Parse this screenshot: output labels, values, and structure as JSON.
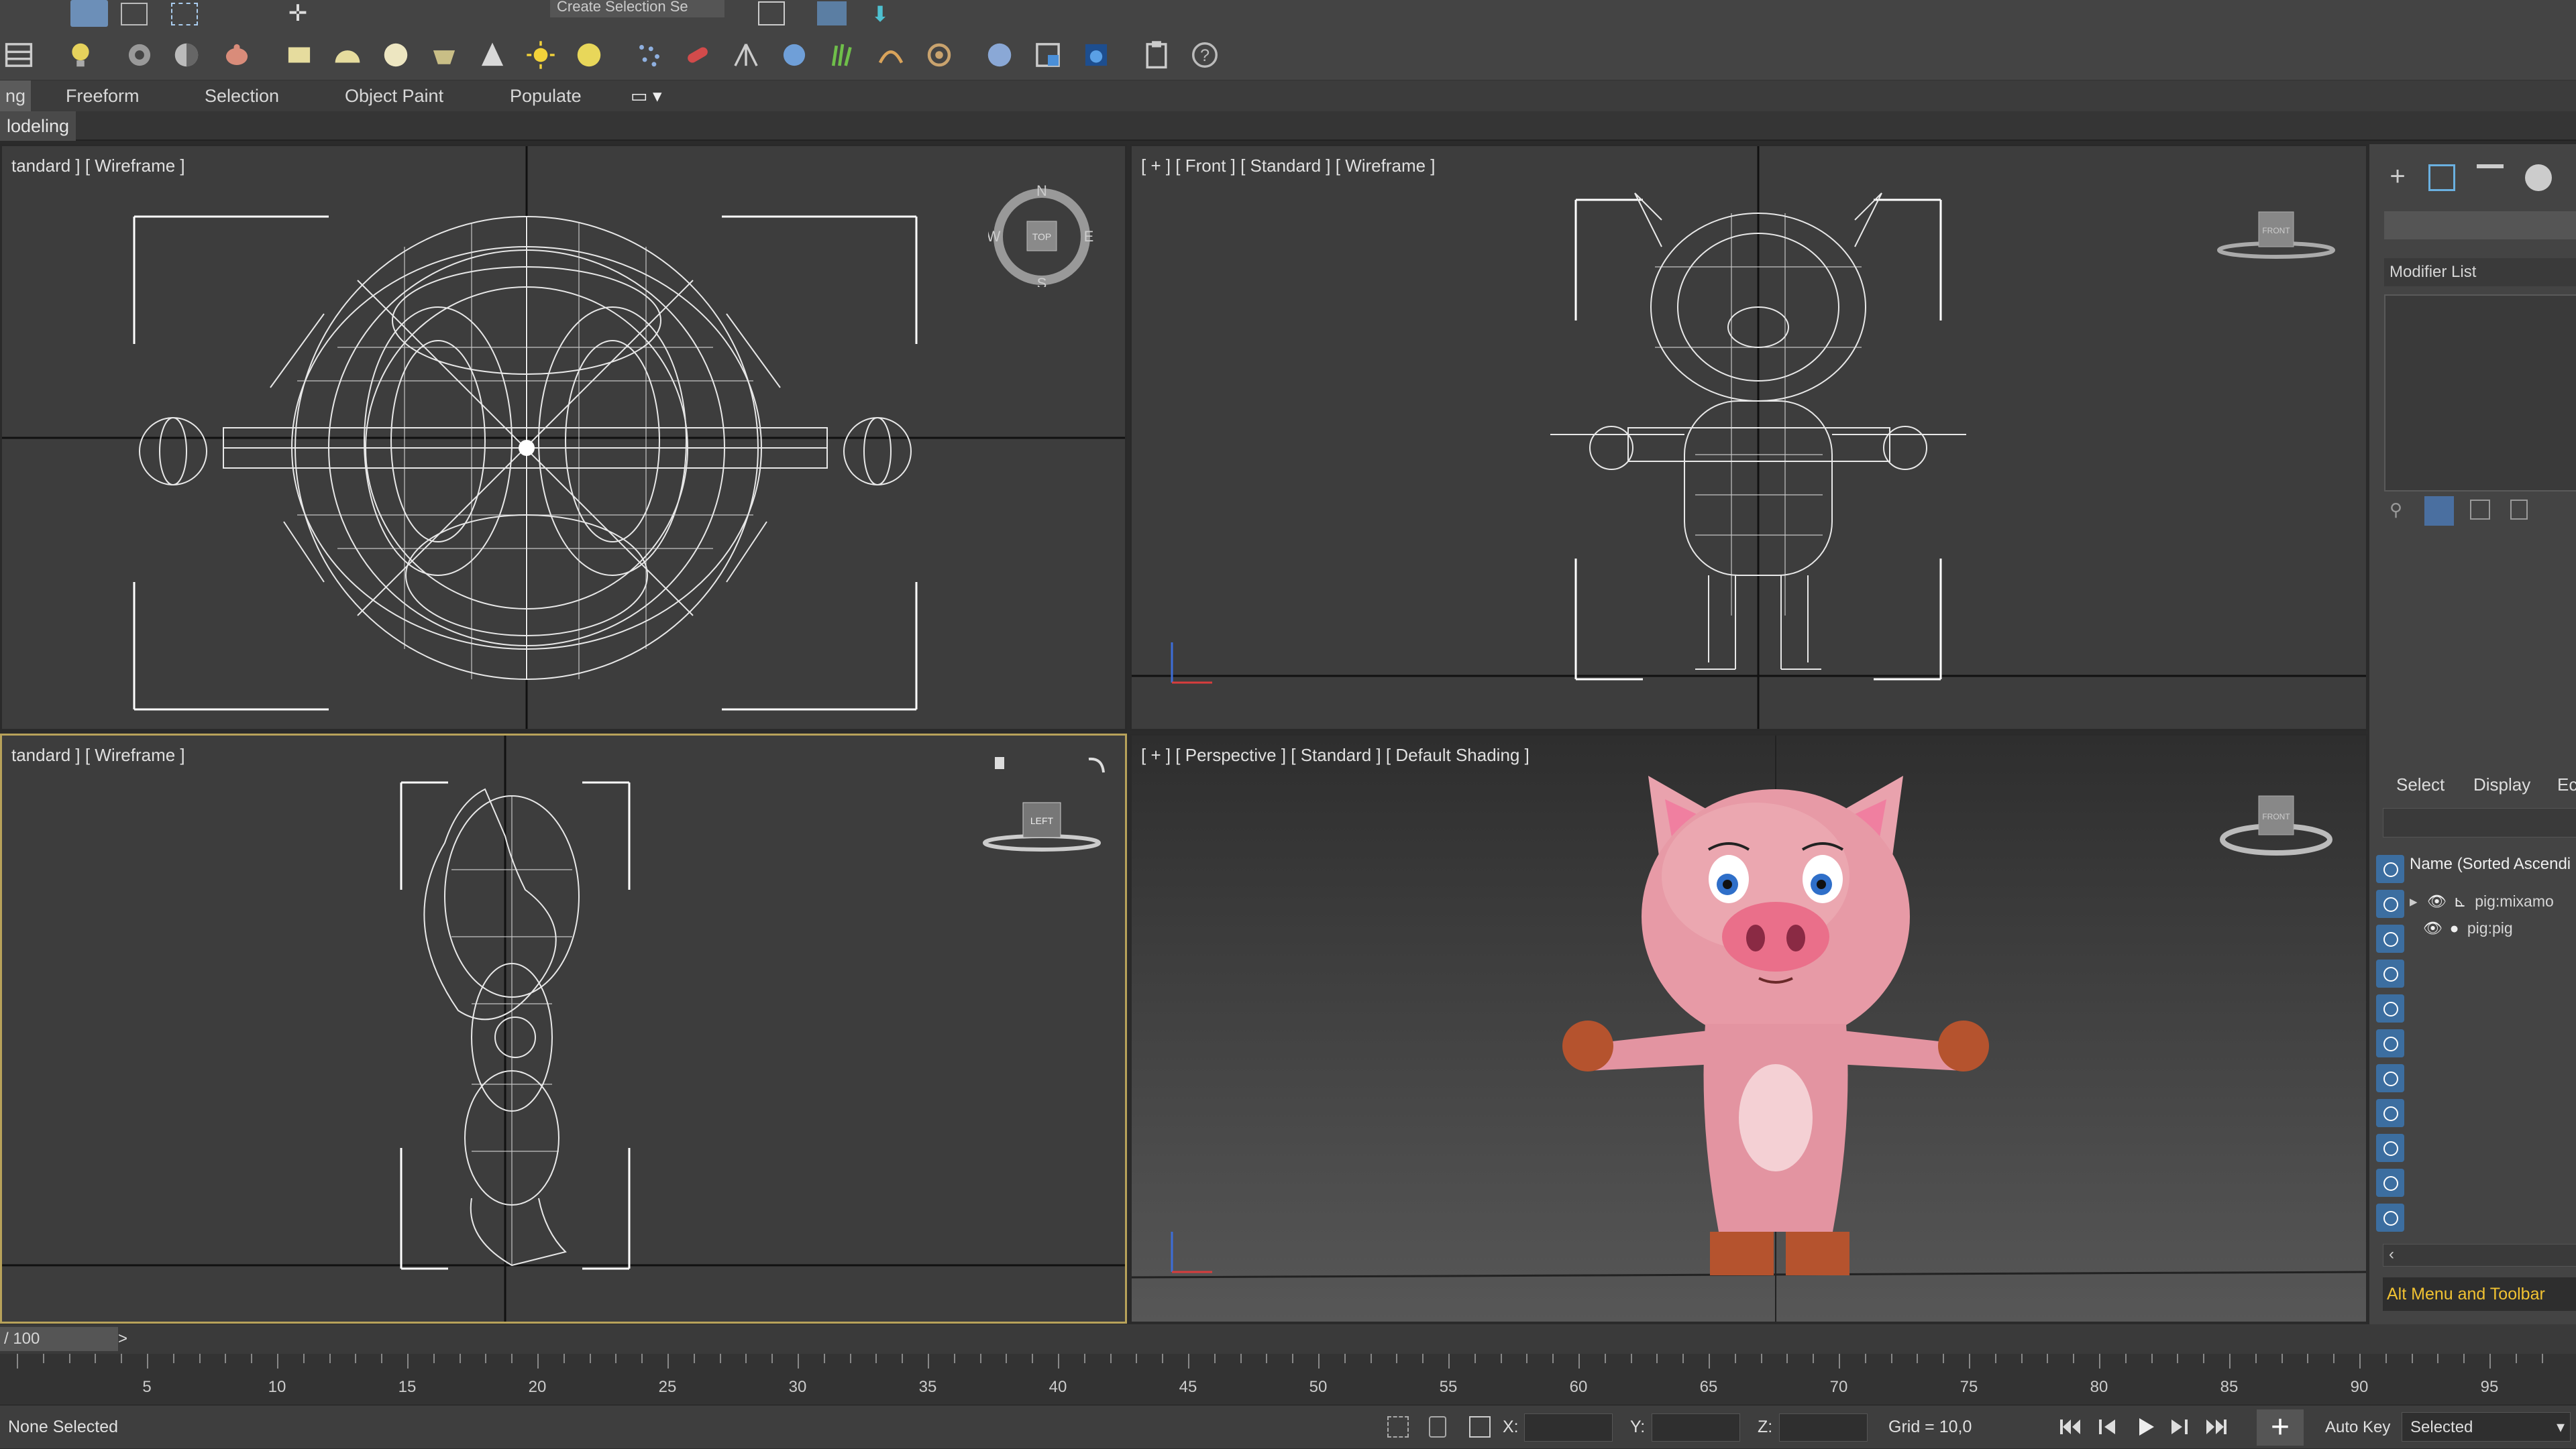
{
  "toolbar": {
    "selection_set": "Create Selection Se",
    "help": "?"
  },
  "ribbon": {
    "tabs": [
      "ng",
      "Freeform",
      "Selection",
      "Object Paint",
      "Populate"
    ],
    "sub_label": "lodeling"
  },
  "viewports": {
    "top": {
      "label": "tandard ] [ Wireframe ]",
      "compass": {
        "n": "N",
        "s": "S",
        "e": "E",
        "w": "W",
        "cube": "TOP"
      }
    },
    "front": {
      "label": "[ + ] [ Front ] [ Standard ] [ Wireframe ]",
      "cube": "FRONT"
    },
    "left": {
      "label": "tandard ] [ Wireframe ]",
      "cube": "LEFT"
    },
    "perspective": {
      "label": "[ + ] [ Perspective ] [ Standard ] [ Default Shading ]",
      "cube": "FRONT"
    }
  },
  "command_panel": {
    "modifier_list": "Modifier List"
  },
  "scene_explorer": {
    "tabs": [
      "Select",
      "Display",
      "Ec"
    ],
    "column_header": "Name (Sorted Ascendi",
    "items": [
      {
        "name": "pig:mixamo",
        "expandable": true
      },
      {
        "name": "pig:pig",
        "expandable": false
      }
    ],
    "tooltip": "Alt Menu and Toolbar"
  },
  "timeline": {
    "frame_counter": "/ 100",
    "next": ">",
    "ticks": [
      5,
      10,
      15,
      20,
      25,
      30,
      35,
      40,
      45,
      50,
      55,
      60,
      65,
      70,
      75,
      80,
      85,
      90,
      95
    ]
  },
  "status": {
    "selection": "None Selected",
    "x_label": "X:",
    "y_label": "Y:",
    "z_label": "Z:",
    "grid": "Grid = 10,0",
    "autokey": "Auto Key",
    "selected": "Selected"
  },
  "colors": {
    "accent_active_viewport": "#b8a25a",
    "pig_pink": "#e69aa6",
    "hooves": "#b5532e",
    "tooltip_text": "#f1c232"
  }
}
